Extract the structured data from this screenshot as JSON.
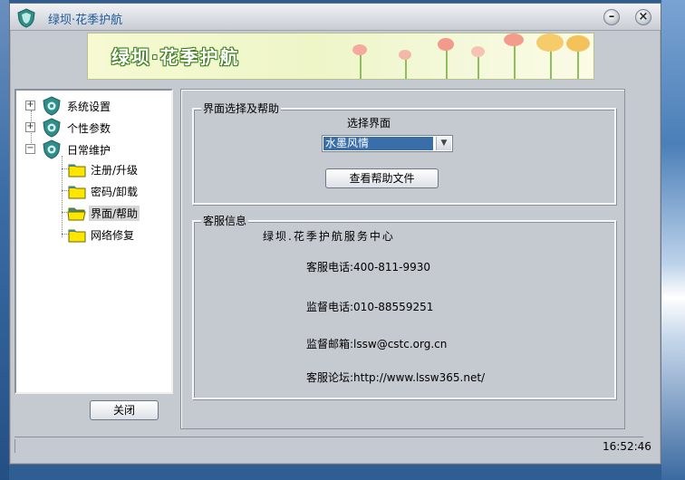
{
  "window": {
    "title": "绿坝·花季护航",
    "minimize_label": "–",
    "close_label": "×"
  },
  "banner": {
    "title": "绿坝·花季护航"
  },
  "tree": {
    "nodes": [
      {
        "label": "系统设置",
        "expander": "+"
      },
      {
        "label": "个性参数",
        "expander": "+"
      },
      {
        "label": "日常维护",
        "expander": "−"
      }
    ],
    "children": [
      {
        "label": "注册/升级"
      },
      {
        "label": "密码/卸载"
      },
      {
        "label": "界面/帮助",
        "selected": true
      },
      {
        "label": "网络修复"
      }
    ]
  },
  "buttons": {
    "close": "关闭",
    "help": "查看帮助文件"
  },
  "ui_section": {
    "legend": "界面选择及帮助",
    "select_label": "选择界面",
    "select_value": "水墨风情"
  },
  "service_section": {
    "legend": "客服信息",
    "center_name": "绿坝.花季护航服务中心",
    "phone": "客服电话:400-811-9930",
    "supervise_phone": "监督电话:010-88559251",
    "email": "监督邮箱:lssw@cstc.org.cn",
    "forum": "客服论坛:http://www.lssw365.net/"
  },
  "status": {
    "time": "16:52:46"
  },
  "colors": {
    "accent": "#3a6ea8",
    "title_text": "#1d5a9a",
    "banner_green": "#3f7f1f"
  }
}
